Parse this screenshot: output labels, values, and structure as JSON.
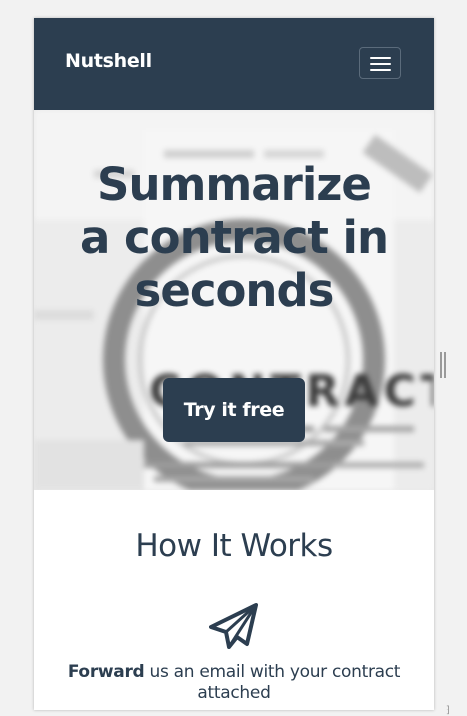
{
  "navbar": {
    "brand": "Nutshell",
    "toggle_icon": "hamburger-menu-icon",
    "background": "#2c3e50"
  },
  "hero": {
    "title_lines": [
      "Summarize",
      "a contract in",
      "seconds"
    ],
    "cta_label": "Try it free",
    "background_image": "blurred-magnifier-over-contract",
    "background_text": "CONTRACT"
  },
  "how_it_works": {
    "title": "How It Works",
    "steps": [
      {
        "icon": "paper-plane-icon",
        "bold": "Forward",
        "text": " us an email with your contract attached"
      }
    ]
  },
  "colors": {
    "primary": "#2c3e50",
    "text_on_primary": "#ffffff",
    "page_background": "#f2f2f2"
  }
}
